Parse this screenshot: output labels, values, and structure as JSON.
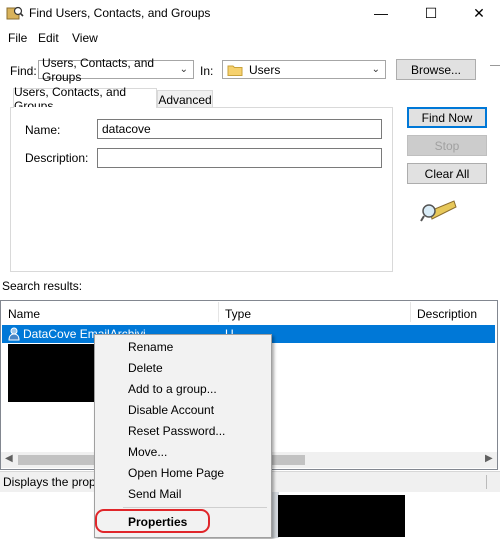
{
  "window": {
    "title": "Find Users, Contacts, and Groups",
    "controls": {
      "minimize": "—",
      "maximize": "☐",
      "close": "✕"
    }
  },
  "menu": {
    "items": [
      "File",
      "Edit",
      "View"
    ]
  },
  "find_row": {
    "find_label": "Find:",
    "find_value": "Users, Contacts, and Groups",
    "in_label": "In:",
    "in_value": "Users",
    "browse_label": "Browse..."
  },
  "tabs": [
    "Users, Contacts, and Groups",
    "Advanced"
  ],
  "form": {
    "name_label": "Name:",
    "name_value": "datacove",
    "description_label": "Description:",
    "description_value": ""
  },
  "buttons": {
    "find_now": "Find Now",
    "stop": "Stop",
    "clear_all": "Clear All"
  },
  "results": {
    "label": "Search results:",
    "columns": [
      "Name",
      "Type",
      "Description"
    ],
    "selected_row_name": "DataCove EmailArchivi",
    "selected_row_type": "U"
  },
  "status_text": "Displays the prope",
  "context_menu": {
    "items": [
      "Rename",
      "Delete",
      "Add to a group...",
      "Disable Account",
      "Reset Password...",
      "Move...",
      "Open Home Page",
      "Send Mail"
    ],
    "properties": "Properties"
  },
  "colors": {
    "selection": "#0078d7",
    "highlight": "#e0262a"
  },
  "icons": [
    "find-users-app-icon",
    "folder-icon",
    "search-flashlight-icon",
    "user-icon",
    "chevron-down-icon"
  ]
}
